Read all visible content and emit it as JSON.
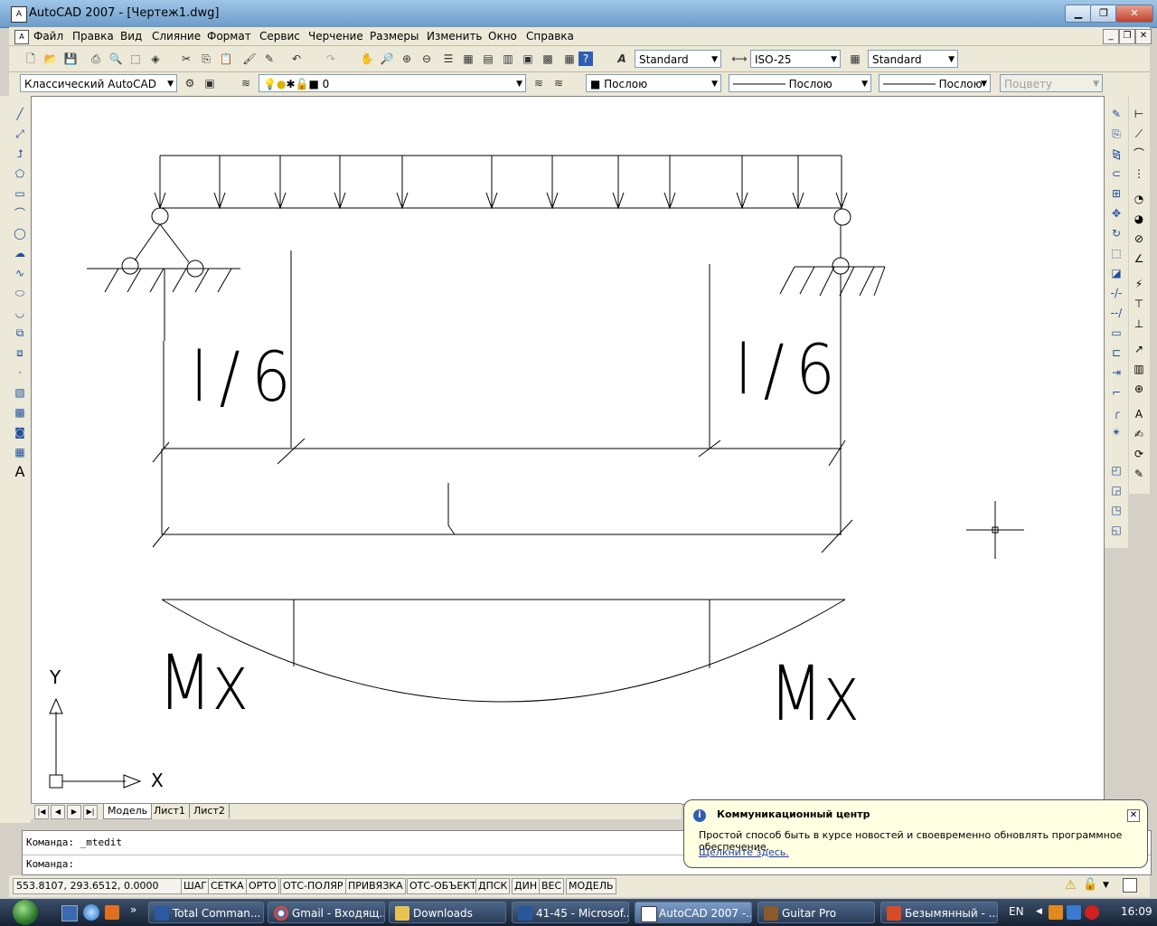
{
  "window": {
    "title": "AutoCAD 2007 - [Чертеж1.dwg]",
    "app_icon": "autocad-icon",
    "buttons": [
      "minimize",
      "restore",
      "close"
    ]
  },
  "menu": {
    "items": [
      "Файл",
      "Правка",
      "Вид",
      "Слияние",
      "Формат",
      "Сервис",
      "Черчение",
      "Размеры",
      "Изменить",
      "Окно",
      "Справка"
    ]
  },
  "toolbar_std": {
    "text_style": "Standard",
    "dim_style": "ISO-25",
    "table_style": "Standard"
  },
  "toolbar_layers": {
    "workspace": "Классический AutoCAD",
    "layer": "0",
    "color": "Послою",
    "linetype": "Послою",
    "lineweight": "Послою",
    "plotstyle": "Поцвету"
  },
  "drawing": {
    "dim_label_left": "l/6",
    "dim_label_right": "l/6",
    "moment_label_left": "Mx",
    "moment_label_right": "Mx",
    "ucs_x": "X",
    "ucs_y": "Y"
  },
  "layout_tabs": [
    "Модель",
    "Лист1",
    "Лист2"
  ],
  "command": {
    "history": "Команда:  _mtedit",
    "prompt": "Команда:"
  },
  "status": {
    "coords": "553.8107, 293.6512, 0.0000",
    "toggles": [
      "ШАГ",
      "СЕТКА",
      "ОРТО",
      "ОТС-ПОЛЯР",
      "ПРИВЯЗКА",
      "ОТС-ОБЪЕКТ",
      "ДПСК",
      "ДИН",
      "ВЕС",
      "МОДЕЛЬ"
    ]
  },
  "balloon": {
    "title": "Коммуникационный центр",
    "text": "Простой способ быть в курсе новостей и своевременно обновлять программное обеспечение.",
    "link": "Щелкните здесь."
  },
  "taskbar": {
    "tasks": [
      {
        "label": "Total Comman...",
        "icon": "total-commander-icon",
        "active": false
      },
      {
        "label": "Gmail - Входящ...",
        "icon": "chrome-icon",
        "active": false
      },
      {
        "label": "Downloads",
        "icon": "folder-icon",
        "active": false
      },
      {
        "label": "41-45 - Microsof...",
        "icon": "word-icon",
        "active": false
      },
      {
        "label": "AutoCAD 2007 -...",
        "icon": "autocad-icon",
        "active": true
      },
      {
        "label": "Guitar Pro",
        "icon": "guitar-pro-icon",
        "active": false
      },
      {
        "label": "Безымянный - ...",
        "icon": "paint-icon",
        "active": false
      }
    ],
    "language": "EN",
    "clock": "16:09"
  }
}
